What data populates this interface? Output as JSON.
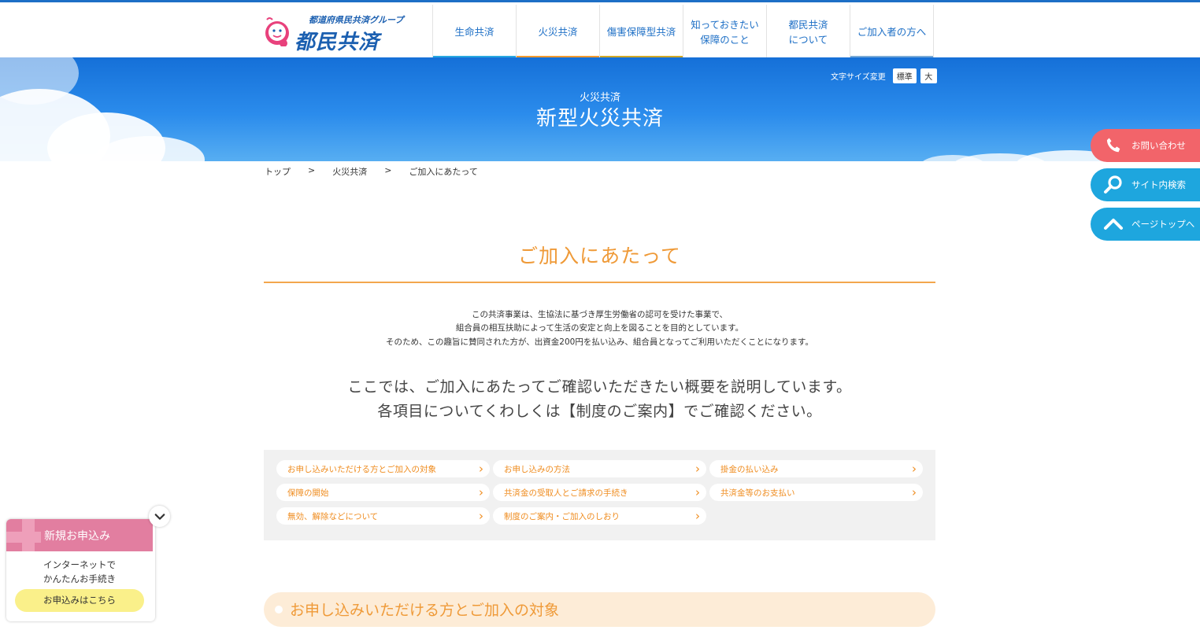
{
  "logo": {
    "group_text": "都道府県民共済グループ",
    "brand_text": "都民共済"
  },
  "nav": {
    "items": [
      {
        "label": "生命共済",
        "bar_color": "#29a8e0"
      },
      {
        "label": "火災共済",
        "bar_color": "#f29a2e"
      },
      {
        "label": "傷害保障型共済",
        "bar_color": "#d1a826"
      },
      {
        "label": "知っておきたい\n保障のこと",
        "bar_color": "#ffffff"
      },
      {
        "label": "都民共済\nについて",
        "bar_color": "#ffffff"
      },
      {
        "label": "ご加入者の方へ",
        "bar_color": "#7aaad6"
      }
    ]
  },
  "hero": {
    "category": "火災共済",
    "title": "新型火災共済",
    "font_size_label": "文字サイズ変更",
    "font_size_standard": "標準",
    "font_size_large": "大"
  },
  "breadcrumb": {
    "items": [
      "トップ",
      "火災共済",
      "ご加入にあたって"
    ],
    "separator": ">"
  },
  "main": {
    "heading": "ご加入にあたって",
    "intro_lines": [
      "この共済事業は、生協法に基づき厚生労働省の認可を受けた事業で、",
      "組合員の相互扶助によって生活の安定と向上を図ることを目的としています。",
      "そのため、この趣旨に賛同された方が、出資金200円を払い込み、組合員となってご利用いただくことになります。"
    ],
    "lead_lines": [
      "ここでは、ご加入にあたってご確認いただきたい概要を説明しています。",
      "各項目についてくわしくは【制度のご案内】でご確認ください。"
    ],
    "links": [
      "お申し込みいただける方とご加入の対象",
      "お申し込みの方法",
      "掛金の払い込み",
      "保障の開始",
      "共済金の受取人とご請求の手続き",
      "共済金等のお支払い",
      "無効、解除などについて",
      "制度のご案内・ご加入のしおり"
    ],
    "link_chevron": "›",
    "section_title": "お申し込みいただける方とご加入の対象"
  },
  "side_buttons": [
    {
      "label": "お問い合わせ",
      "icon": "phone-icon",
      "color": "#f2646a"
    },
    {
      "label": "サイト内検索",
      "icon": "search-icon",
      "color": "#1ea6de"
    },
    {
      "label": "ページトップへ",
      "icon": "chevron-up-icon",
      "color": "#1ea6de"
    }
  ],
  "apply": {
    "title": "新規お申込み",
    "text_lines": [
      "インターネットで",
      "かんたんお手続き"
    ],
    "button": "お申込みはこちら",
    "toggle_icon": "chevron-down-icon"
  },
  "colors": {
    "brand_blue": "#1d6fc6",
    "accent_orange": "#ef9a38",
    "apply_pink": "#e27ea0",
    "apply_button": "#faf08a"
  }
}
